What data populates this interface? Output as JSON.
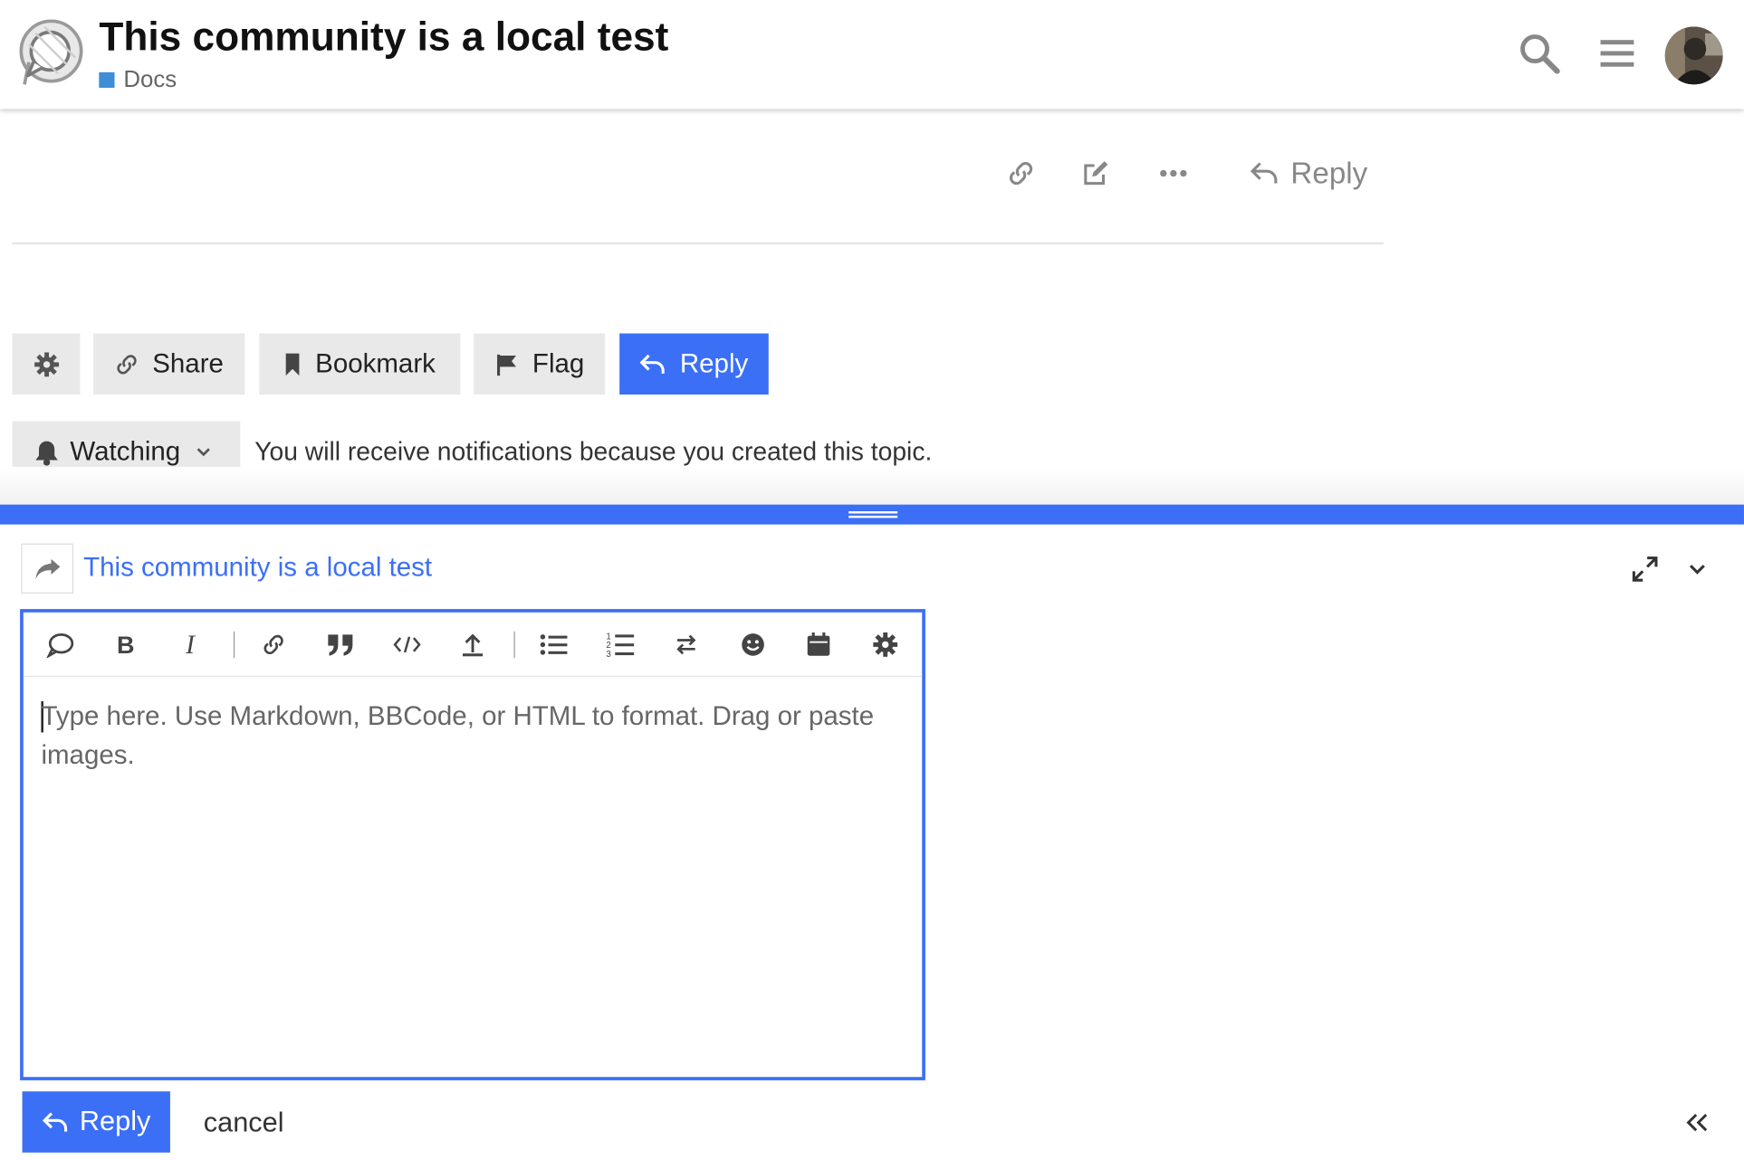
{
  "header": {
    "title": "This community is a local test",
    "category": "Docs",
    "category_color": "#3c8fd6",
    "icons": [
      "discourse-logo",
      "search-icon",
      "hamburger-icon",
      "user-avatar"
    ]
  },
  "post_actions": {
    "reply_label": "Reply",
    "icons": [
      "link-icon",
      "edit-icon",
      "more-icon",
      "reply-icon"
    ]
  },
  "footer_buttons": {
    "share": "Share",
    "bookmark": "Bookmark",
    "flag": "Flag",
    "reply": "Reply"
  },
  "notifications": {
    "level": "Watching",
    "reason": "You will receive notifications because you created this topic."
  },
  "composer": {
    "topic_title": "This community is a local test",
    "placeholder": "Type here. Use Markdown, BBCode, or HTML to format. Drag or paste images.",
    "submit_label": "Reply",
    "cancel_label": "cancel",
    "toolbar": [
      "speech-bubble-icon",
      "bold-icon",
      "italic-icon",
      "link-icon",
      "quote-icon",
      "code-icon",
      "upload-icon",
      "bullet-list-icon",
      "numbered-list-icon",
      "rtl-toggle-icon",
      "emoji-icon",
      "calendar-icon",
      "gear-icon"
    ]
  },
  "colors": {
    "primary": "#3b6ff6",
    "button_bg": "#e9e9e9",
    "text": "#222222",
    "muted": "#888888"
  }
}
